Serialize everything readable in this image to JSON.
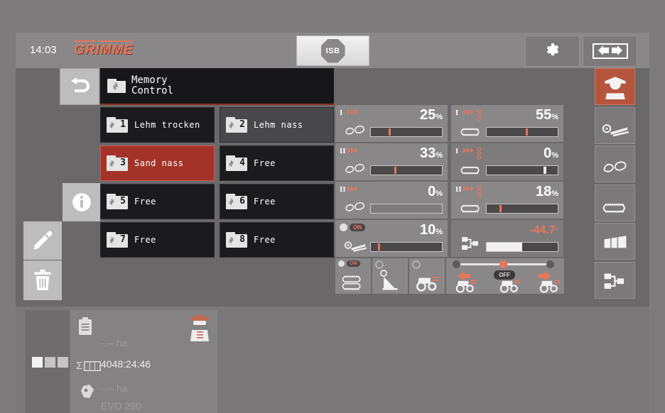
{
  "topbar": {
    "clock": "14:03",
    "brand": "GRIMME",
    "isb_label": "ISB",
    "gear_icon": "gear-icon",
    "swap_icon": "swap-arrows-icon"
  },
  "nav": {
    "back_icon": "back-arrow-icon",
    "info_icon": "info-icon",
    "edit_icon": "pencil-icon",
    "delete_icon": "trash-icon"
  },
  "memory": {
    "title_line1": "Memory",
    "title_line2": "Control",
    "folder_icon": "folder-gear-icon",
    "slots": [
      {
        "num": "1",
        "label": "Lehm trocken",
        "state": "dark"
      },
      {
        "num": "2",
        "label": "Lehm nass",
        "state": "mid"
      },
      {
        "num": "3",
        "label": "Sand nass",
        "state": "selected"
      },
      {
        "num": "4",
        "label": "Free",
        "state": "dark"
      },
      {
        "num": "5",
        "label": "Free",
        "state": "dark"
      },
      {
        "num": "6",
        "label": "Free",
        "state": "dark"
      },
      {
        "num": "7",
        "label": "Free",
        "state": "dark"
      },
      {
        "num": "8",
        "label": "Free",
        "state": "dark"
      }
    ]
  },
  "readouts": [
    {
      "name": "web-speed-1",
      "value": "25",
      "unit": "%",
      "marker": 25,
      "bar": "tick",
      "roman": "I",
      "icon": "sieve-web-roller-icon"
    },
    {
      "name": "sieve-belt-1",
      "value": "55",
      "unit": "%",
      "marker": 55,
      "bar": "tick",
      "roman": "I",
      "icon": "sieve-belt-icon"
    },
    {
      "name": "web-speed-2",
      "value": "33",
      "unit": "%",
      "marker": 33,
      "bar": "tick",
      "roman": "II",
      "icon": "sieve-web-roller-icon"
    },
    {
      "name": "sieve-angle-1",
      "value": "0",
      "unit": "%",
      "marker": 80,
      "bar": "tickw",
      "roman": "I",
      "icon": "sieve-gauge-icon"
    },
    {
      "name": "web-speed-3",
      "value": "0",
      "unit": "%",
      "marker": 0,
      "bar": "none",
      "roman": "II",
      "icon": "sieve-web-off-icon"
    },
    {
      "name": "sieve-belt-2",
      "value": "18",
      "unit": "%",
      "marker": 18,
      "bar": "tick",
      "roman": "II",
      "icon": "sieve-belt-icon"
    },
    {
      "name": "haulm-roller",
      "value": "10",
      "unit": "%",
      "marker": 10,
      "bar": "tick",
      "roman": "",
      "icon": "haulm-roller-icon",
      "toggle": "ON"
    },
    {
      "name": "steering-angle",
      "value": "-44.7",
      "unit": "°",
      "marker": 50,
      "bar": "fillw",
      "roman": "",
      "icon": "axle-diagram-icon"
    }
  ],
  "quickbuttons": [
    {
      "name": "sieve-web-button",
      "icon": "sieve-web-icon",
      "toggle": "ON"
    },
    {
      "name": "haulm-unit-button",
      "icon": "haulm-unit-icon"
    },
    {
      "name": "tractor-button",
      "icon": "tractor-icon"
    },
    {
      "name": "steering-button",
      "icon": "steering-slider-icon",
      "toggle": "OFF"
    }
  ],
  "sidebar": [
    {
      "name": "sidebar-item-operator",
      "icon": "operator-icon",
      "active": true
    },
    {
      "name": "sidebar-item-haulm",
      "icon": "haulm-roller-icon",
      "active": false
    },
    {
      "name": "sidebar-item-web",
      "icon": "web-roller-icon",
      "active": false
    },
    {
      "name": "sidebar-item-sieve",
      "icon": "sieve-belt-icon",
      "active": false
    },
    {
      "name": "sidebar-item-bunker",
      "icon": "bunker-icon",
      "active": false
    },
    {
      "name": "sidebar-item-axle",
      "icon": "axle-diagram-icon",
      "active": false
    }
  ],
  "status": {
    "area_icon": "clipboard-icon",
    "area_value": "-.-- ha",
    "hours_icon": "sum-counter-icon",
    "hours_prefix": "Σ",
    "hours_value": "4048:24:46",
    "yield_icon": "potato-icon",
    "yield_value": "-.-- ha",
    "machine": "EVO 290",
    "operator_icon": "operator-icon"
  },
  "colors": {
    "accent": "#e8765a",
    "selected": "#a33329",
    "active_tab": "#b5563c",
    "panel": "#8a8788",
    "dark": "#1b1b1e"
  }
}
